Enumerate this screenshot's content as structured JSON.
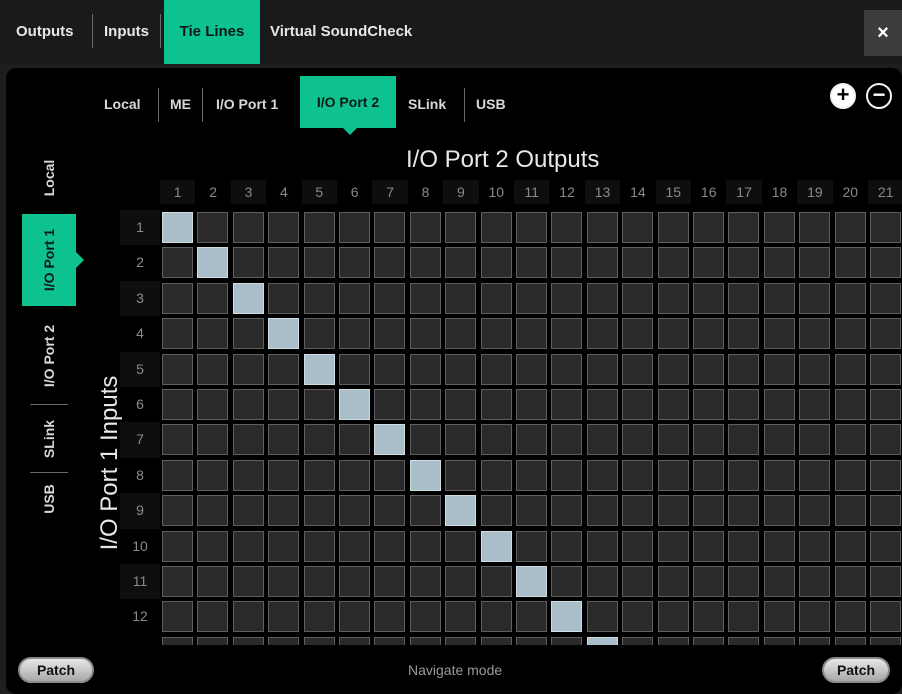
{
  "top_tabs": [
    {
      "label": "Outputs",
      "active": false
    },
    {
      "label": "Inputs",
      "active": false
    },
    {
      "label": "Tie Lines",
      "active": true
    },
    {
      "label": "Virtual SoundCheck",
      "active": false
    }
  ],
  "close_label": "×",
  "output_tabs": [
    {
      "label": "Local",
      "active": false
    },
    {
      "label": "ME",
      "active": false
    },
    {
      "label": "I/O Port 1",
      "active": false
    },
    {
      "label": "I/O Port 2",
      "active": true
    },
    {
      "label": "SLink",
      "active": false
    },
    {
      "label": "USB",
      "active": false
    }
  ],
  "zoom_in_label": "+",
  "zoom_out_label": "−",
  "input_tabs": [
    {
      "label": "Local",
      "active": false
    },
    {
      "label": "I/O Port 1",
      "active": true
    },
    {
      "label": "I/O Port 2",
      "active": false
    },
    {
      "label": "SLink",
      "active": false
    },
    {
      "label": "USB",
      "active": false
    }
  ],
  "matrix": {
    "column_title": "I/O Port 2 Outputs",
    "row_title": "I/O Port 1 Inputs",
    "columns": [
      "1",
      "2",
      "3",
      "4",
      "5",
      "6",
      "7",
      "8",
      "9",
      "10",
      "11",
      "12",
      "13",
      "14",
      "15",
      "16",
      "17",
      "18",
      "19",
      "20",
      "21"
    ],
    "rows": [
      "1",
      "2",
      "3",
      "4",
      "5",
      "6",
      "7",
      "8",
      "9",
      "10",
      "11",
      "12"
    ],
    "patched": [
      [
        1,
        1
      ],
      [
        2,
        2
      ],
      [
        3,
        3
      ],
      [
        4,
        4
      ],
      [
        5,
        5
      ],
      [
        6,
        6
      ],
      [
        7,
        7
      ],
      [
        8,
        8
      ],
      [
        9,
        9
      ],
      [
        10,
        10
      ],
      [
        11,
        11
      ],
      [
        12,
        12
      ],
      [
        13,
        13
      ]
    ]
  },
  "bottom": {
    "patch_left_label": "Patch",
    "mode_text": "Navigate mode",
    "patch_right_label": "Patch"
  },
  "colors": {
    "accent": "#0ec28f",
    "patched_cell": "#a9bec8",
    "empty_cell": "#2a2a2a"
  }
}
